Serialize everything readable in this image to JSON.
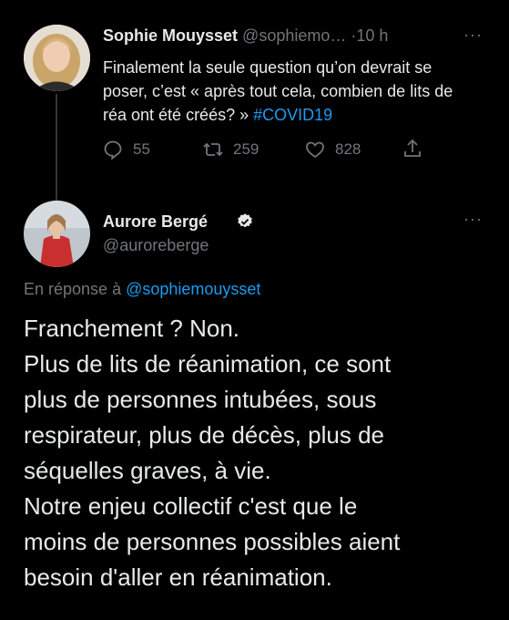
{
  "parent_tweet": {
    "author_name": "Sophie Mouysset",
    "handle": "@sophiemo…",
    "separator": "·",
    "time": "10 h",
    "text_main": "Finalement la seule question qu’on devrait se poser, c’est « après tout cela, combien de lits de réa ont été créés? » ",
    "hashtag": "#COVID19",
    "actions": {
      "replies": "55",
      "retweets": "259",
      "likes": "828"
    },
    "icons": [
      "reply-icon",
      "retweet-icon",
      "like-icon",
      "share-icon",
      "more-icon"
    ]
  },
  "main_tweet": {
    "author_name": "Aurore Bergé",
    "handle": "@auroreberge",
    "verified": true,
    "reply_prefix": "En réponse à ",
    "reply_to": "@sophiemouysset",
    "lines": [
      "Franchement ? Non.",
      "Plus de lits de réanimation, ce sont",
      "plus de personnes intubées, sous",
      "respirateur, plus de décès, plus de",
      "séquelles graves, à vie.",
      "Notre enjeu collectif c'est que le",
      "moins de personnes possibles aient",
      "besoin d'aller en réanimation."
    ]
  },
  "colors": {
    "background": "#000000",
    "text": "#e7e9ea",
    "muted": "#71767b",
    "accent": "#1d9bf0",
    "divider": "#2f3336"
  }
}
